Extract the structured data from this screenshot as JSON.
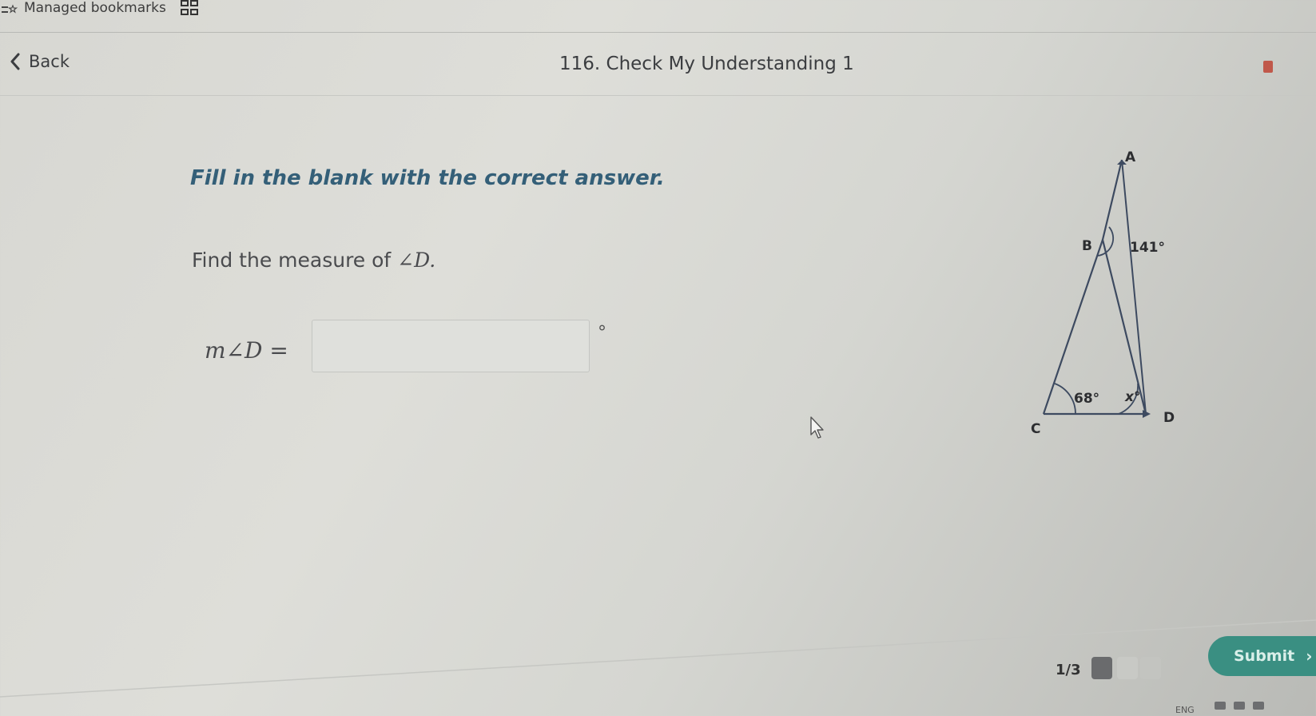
{
  "bookmarks_bar": {
    "folder_label": "Managed bookmarks",
    "folder_icon": "bookmark-folder-icon",
    "apps_icon": "apps-grid-icon"
  },
  "header": {
    "back_label": "Back",
    "back_icon": "chevron-left-icon",
    "title": "116. Check My Understanding 1"
  },
  "question": {
    "instruction": "Fill in the blank with the correct answer.",
    "prompt_text": "Find the measure of ",
    "prompt_math": "∠D.",
    "answer_label": "m∠D =",
    "answer_value": "",
    "answer_unit": "°"
  },
  "figure": {
    "points": {
      "A": "A",
      "B": "B",
      "C": "C",
      "D": "D"
    },
    "angle_B_exterior": "141°",
    "angle_C": "68°",
    "angle_D": "x°"
  },
  "footer": {
    "page_counter": "1/3",
    "progress_current": 1,
    "progress_total": 3,
    "submit_label": "Submit",
    "submit_icon": "chevron-right-icon",
    "submit_color": "#3a8f82"
  },
  "taskbar": {
    "language": "ENG"
  }
}
